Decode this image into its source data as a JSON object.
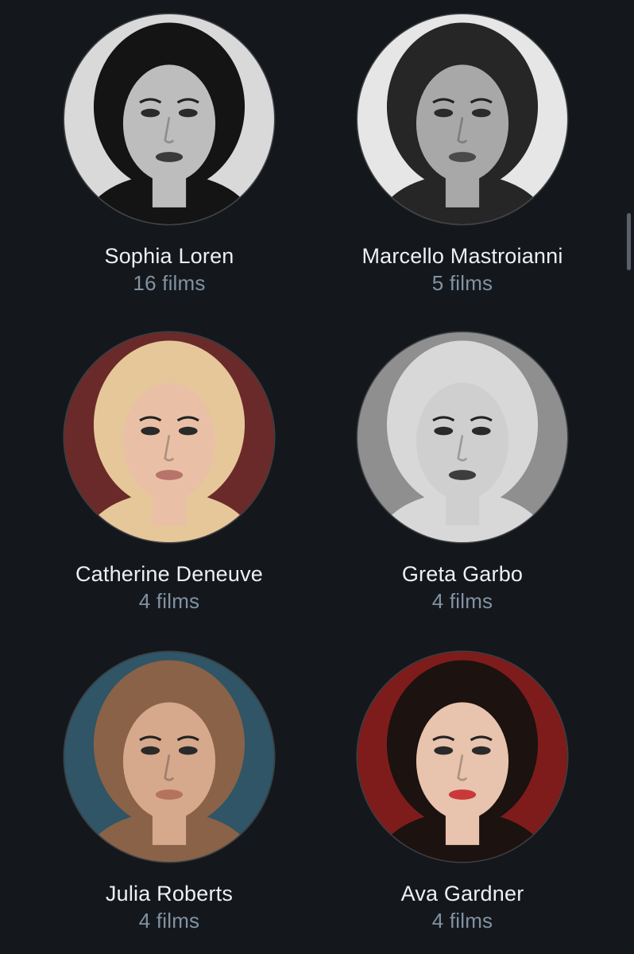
{
  "people": [
    {
      "name": "Sophia Loren",
      "films": "16 films",
      "photo_icon": "portrait-bw-dark-hair",
      "palette": {
        "bg": "#d9d9d9",
        "hair": "#141414",
        "skin": "#bdbdbd",
        "lips": "#3a3a3a"
      }
    },
    {
      "name": "Marcello Mastroianni",
      "films": "5 films",
      "photo_icon": "portrait-bw-man",
      "palette": {
        "bg": "#e6e6e6",
        "hair": "#262626",
        "skin": "#a8a8a8",
        "lips": "#4a4a4a"
      }
    },
    {
      "name": "Catherine Deneuve",
      "films": "4 films",
      "photo_icon": "portrait-color-blonde",
      "palette": {
        "bg": "#6b2a2a",
        "hair": "#e6c79a",
        "skin": "#e9c0a6",
        "lips": "#b8736a"
      }
    },
    {
      "name": "Greta Garbo",
      "films": "4 films",
      "photo_icon": "portrait-bw-hat",
      "palette": {
        "bg": "#8f8f8f",
        "hair": "#d8d8d8",
        "skin": "#cfcfcf",
        "lips": "#3d3d3d"
      }
    },
    {
      "name": "Julia Roberts",
      "films": "4 films",
      "photo_icon": "portrait-color-brunette",
      "palette": {
        "bg": "#2f5566",
        "hair": "#8a6247",
        "skin": "#d6a88c",
        "lips": "#b5735e"
      }
    },
    {
      "name": "Ava Gardner",
      "films": "4 films",
      "photo_icon": "portrait-color-dark-hair",
      "palette": {
        "bg": "#7e1c1c",
        "hair": "#1c1210",
        "skin": "#e8c3ad",
        "lips": "#c9393a"
      }
    }
  ]
}
